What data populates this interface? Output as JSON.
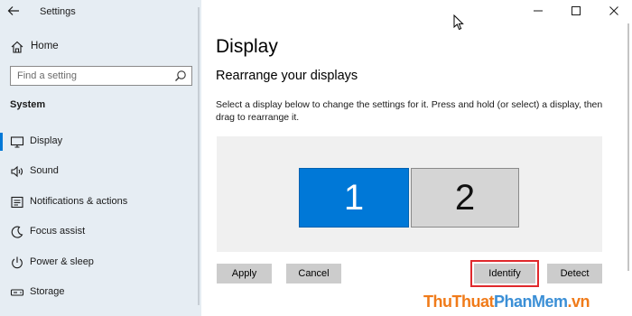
{
  "window": {
    "title": "Settings"
  },
  "sidebar": {
    "home_label": "Home",
    "search": {
      "placeholder": "Find a setting"
    },
    "section_title": "System",
    "items": [
      {
        "label": "Display",
        "icon": "monitor-icon",
        "active": true
      },
      {
        "label": "Sound",
        "icon": "speaker-icon",
        "active": false
      },
      {
        "label": "Notifications & actions",
        "icon": "notification-icon",
        "active": false
      },
      {
        "label": "Focus assist",
        "icon": "moon-icon",
        "active": false
      },
      {
        "label": "Power & sleep",
        "icon": "power-icon",
        "active": false
      },
      {
        "label": "Storage",
        "icon": "storage-icon",
        "active": false
      }
    ]
  },
  "main": {
    "title": "Display",
    "section_title": "Rearrange your displays",
    "instructions": "Select a display below to change the settings for it. Press and hold (or select) a display, then drag to rearrange it.",
    "monitors": [
      {
        "label": "1",
        "selected": true
      },
      {
        "label": "2",
        "selected": false
      }
    ],
    "buttons": {
      "apply": "Apply",
      "cancel": "Cancel",
      "identify": "Identify",
      "detect": "Detect"
    }
  },
  "watermark": {
    "part1": "ThuThuat",
    "part2": "PhanMem",
    "part3": ".vn"
  },
  "colors": {
    "accent": "#0078d7",
    "sidebar_bg": "#e6edf3",
    "highlight": "#e0282c"
  }
}
